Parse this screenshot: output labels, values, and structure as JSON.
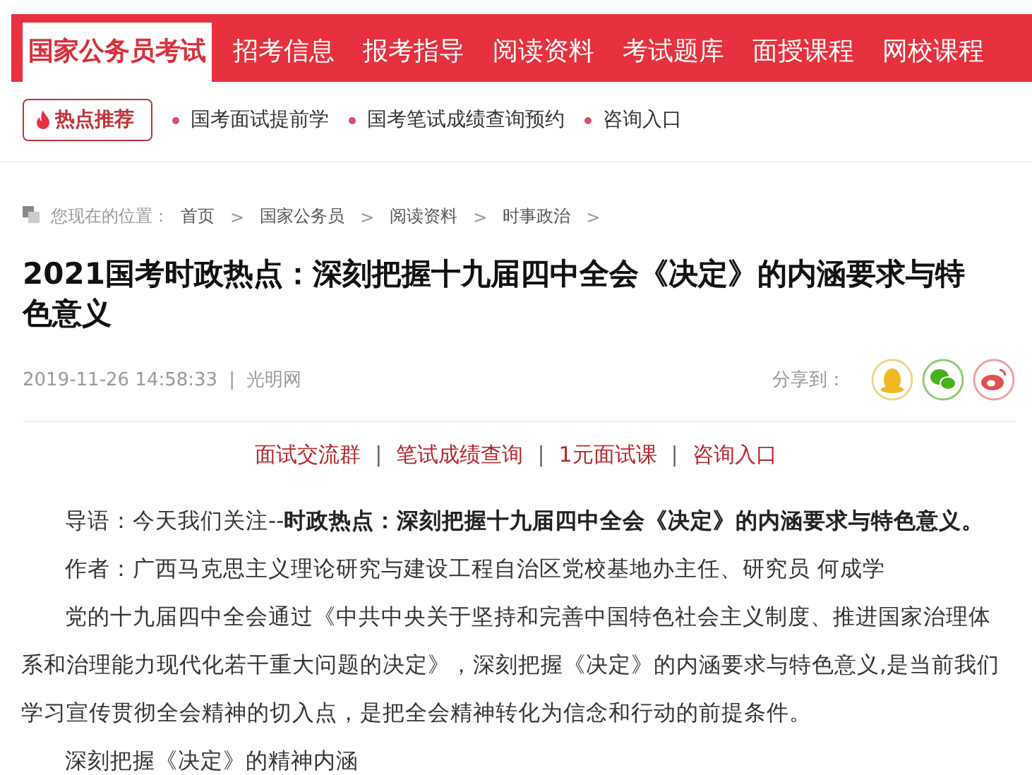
{
  "nav": {
    "tabs": [
      {
        "label": "国家公务员考试",
        "selected": true
      },
      {
        "label": "招考信息",
        "selected": false
      },
      {
        "label": "报考指导",
        "selected": false
      },
      {
        "label": "阅读资料",
        "selected": false
      },
      {
        "label": "考试题库",
        "selected": false
      },
      {
        "label": "面授课程",
        "selected": false
      },
      {
        "label": "网校课程",
        "selected": false
      }
    ]
  },
  "hot": {
    "badge": "热点推荐",
    "links": [
      "国考面试提前学",
      "国考笔试成绩查询预约",
      "咨询入口"
    ]
  },
  "breadcrumb": {
    "prefix": "您现在的位置：",
    "items": [
      {
        "label": "首页",
        "sep": ">"
      },
      {
        "label": "国家公务员",
        "sep": ">"
      },
      {
        "label": "阅读资料",
        "sep": ">"
      },
      {
        "label": "时事政治",
        "sep": ">"
      }
    ]
  },
  "article": {
    "title": "2021国考时政热点：深刻把握十九届四中全会《决定》的内涵要求与特色意义",
    "date": "2019-11-26 14:58:33",
    "divider": "|",
    "source": "光明网",
    "share_label": "分享到：",
    "share": [
      {
        "kind": "qq"
      },
      {
        "kind": "wechat"
      },
      {
        "kind": "weibo"
      }
    ]
  },
  "promo": [
    {
      "kind": "link",
      "text": "面试交流群"
    },
    {
      "kind": "sep",
      "text": "|"
    },
    {
      "kind": "link",
      "text": "笔试成绩查询"
    },
    {
      "kind": "sep",
      "text": "|"
    },
    {
      "kind": "link",
      "text": "1元面试课"
    },
    {
      "kind": "sep",
      "text": "|"
    },
    {
      "kind": "link",
      "text": "咨询入口"
    }
  ],
  "paragraphs": [
    "导语：今天我们关注--**时政热点：深刻把握十九届四中全会《决定》的内涵要求与特色意义。**",
    "作者：广西马克思主义理论研究与建设工程自治区党校基地办主任、研究员 何成学",
    "党的十九届四中全会通过《中共中央关于坚持和完善中国特色社会主义制度、推进国家治理体系和治理能力现代化若干重大问题的决定》，深刻把握《决定》的内涵要求与特色意义,是当前我们学习宣传贯彻全会精神的切入点，是把全会精神转化为信念和行动的前提条件。",
    "深刻把握《决定》的精神内涵"
  ]
}
